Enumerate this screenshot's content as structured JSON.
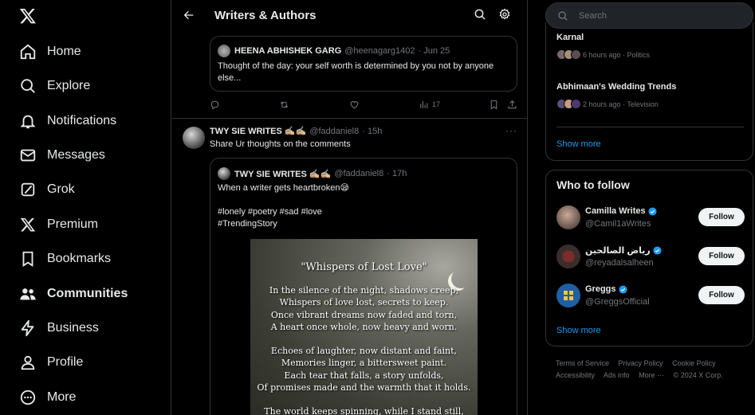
{
  "nav": {
    "items": [
      {
        "label": "Home",
        "icon": "home-icon"
      },
      {
        "label": "Explore",
        "icon": "search-icon"
      },
      {
        "label": "Notifications",
        "icon": "bell-icon"
      },
      {
        "label": "Messages",
        "icon": "envelope-icon"
      },
      {
        "label": "Grok",
        "icon": "grok-icon"
      },
      {
        "label": "Premium",
        "icon": "x-logo-icon"
      },
      {
        "label": "Bookmarks",
        "icon": "bookmark-icon"
      },
      {
        "label": "Communities",
        "icon": "people-icon",
        "active": true
      },
      {
        "label": "Business",
        "icon": "lightning-icon"
      },
      {
        "label": "Profile",
        "icon": "person-icon"
      },
      {
        "label": "More",
        "icon": "more-circle-icon"
      }
    ]
  },
  "header": {
    "title": "Writers & Authors"
  },
  "quoted_post_1": {
    "name": "HEENA ABHISHEK GARG",
    "handle": "@heenagarg1402",
    "date": "· Jun 25",
    "text": "Thought of the day: your self worth is determined by you not by anyone else..."
  },
  "actions": {
    "views": "17"
  },
  "post": {
    "name": "TWY SIE WRITES ✍🏼✍🏼",
    "handle": "@faddaniel8",
    "time": "· 15h",
    "text": "Share Ur thoughts on the comments",
    "more": "···"
  },
  "quoted_post_2": {
    "name": "TWY SIE WRITES ✍🏼✍🏼",
    "handle": "@faddaniel8",
    "time": "· 17h",
    "text": "When a writer gets heartbroken😪\n\n#lonely #poetry #sad #love\n#TrendingStory"
  },
  "poem": {
    "title": "\"Whispers of Lost Love\"",
    "lines": [
      "In the silence of the night, shadows creep,",
      "Whispers of love lost, secrets to keep.",
      "Once vibrant dreams now faded and torn,",
      "A heart once whole, now heavy and worn.",
      "Echoes of laughter, now distant and faint,",
      "Memories linger, a bittersweet paint.",
      "Each tear that falls, a story unfolds,",
      "Of promises made and the warmth that it holds.",
      "The world keeps spinning, while I stand still,"
    ]
  },
  "search": {
    "placeholder": "Search"
  },
  "trends": {
    "items": [
      {
        "title": "Karnal",
        "meta": "6 hours ago · Politics"
      },
      {
        "title": "Abhimaan's Wedding Trends",
        "meta": "2 hours ago · Television"
      }
    ],
    "show_more": "Show more"
  },
  "who_to_follow": {
    "title": "Who to follow",
    "accounts": [
      {
        "name": "Camilla Writes",
        "handle": "@Camil1aWrites",
        "verified": true,
        "button": "Follow"
      },
      {
        "name": "رياض الصالحين",
        "handle": "@reyadalsalheen",
        "verified": true,
        "button": "Follow"
      },
      {
        "name": "Greggs",
        "handle": "@GreggsOfficial",
        "verified": true,
        "button": "Follow"
      }
    ],
    "show_more": "Show more"
  },
  "footer": {
    "links": [
      "Terms of Service",
      "Privacy Policy",
      "Cookie Policy",
      "Accessibility",
      "Ads info",
      "More ···",
      "© 2024 X Corp."
    ]
  },
  "colors": {
    "accent": "#1d9bf0",
    "background": "#000000",
    "border": "#2f3336",
    "muted": "#71767b"
  }
}
